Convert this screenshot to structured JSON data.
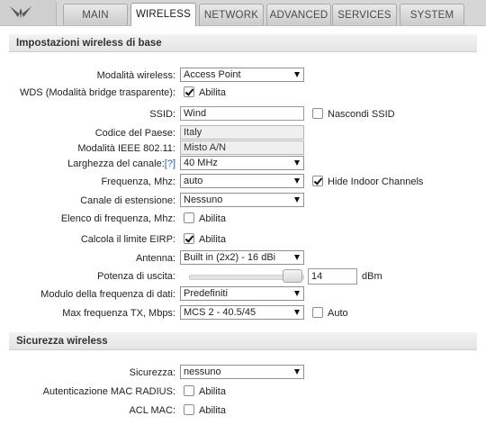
{
  "tabs": [
    {
      "label": "MAIN"
    },
    {
      "label": "WIRELESS"
    },
    {
      "label": "NETWORK"
    },
    {
      "label": "ADVANCED"
    },
    {
      "label": "SERVICES"
    },
    {
      "label": "SYSTEM"
    }
  ],
  "active_tab": "WIRELESS",
  "basic": {
    "title": "Impostazioni wireless di base",
    "mode_label": "Modalità wireless:",
    "mode_value": "Access Point",
    "wds_label": "WDS (Modalità bridge trasparente):",
    "wds_option": "Abilita",
    "wds_checked": true,
    "ssid_label": "SSID:",
    "ssid_value": "Wind",
    "hide_ssid_label": "Nascondi SSID",
    "hide_ssid_checked": false,
    "country_label": "Codice del Paese:",
    "country_value": "Italy",
    "ieee_label": "Modalità IEEE 802.11:",
    "ieee_value": "Misto A/N",
    "width_label": "Larghezza del canale:",
    "width_help": "[?]",
    "width_value": "40 MHz",
    "freq_label": "Frequenza, Mhz:",
    "freq_value": "auto",
    "indoor_label": "Hide Indoor Channels",
    "indoor_checked": true,
    "ext_label": "Canale di estensione:",
    "ext_value": "Nessuno",
    "freqlist_label": "Elenco di frequenza, Mhz:",
    "freqlist_option": "Abilita",
    "freqlist_checked": false,
    "eirp_label": "Calcola il limite EIRP:",
    "eirp_option": "Abilita",
    "eirp_checked": true,
    "antenna_label": "Antenna:",
    "antenna_value": "Built in (2x2) - 16 dBi",
    "power_label": "Potenza di uscita:",
    "power_value": "14",
    "power_unit": "dBm",
    "power_level": 1.0,
    "rate_module_label": "Modulo della frequenza di dati:",
    "rate_module_value": "Predefiniti",
    "maxrate_label": "Max frequenza TX, Mbps:",
    "maxrate_value": "MCS 2 - 40.5/45",
    "auto_label": "Auto",
    "auto_checked": false
  },
  "security": {
    "title": "Sicurezza wireless",
    "security_label": "Sicurezza:",
    "security_value": "nessuno",
    "radius_label": "Autenticazione MAC RADIUS:",
    "radius_option": "Abilita",
    "radius_checked": false,
    "acl_label": "ACL MAC:",
    "acl_option": "Abilita",
    "acl_checked": false
  }
}
